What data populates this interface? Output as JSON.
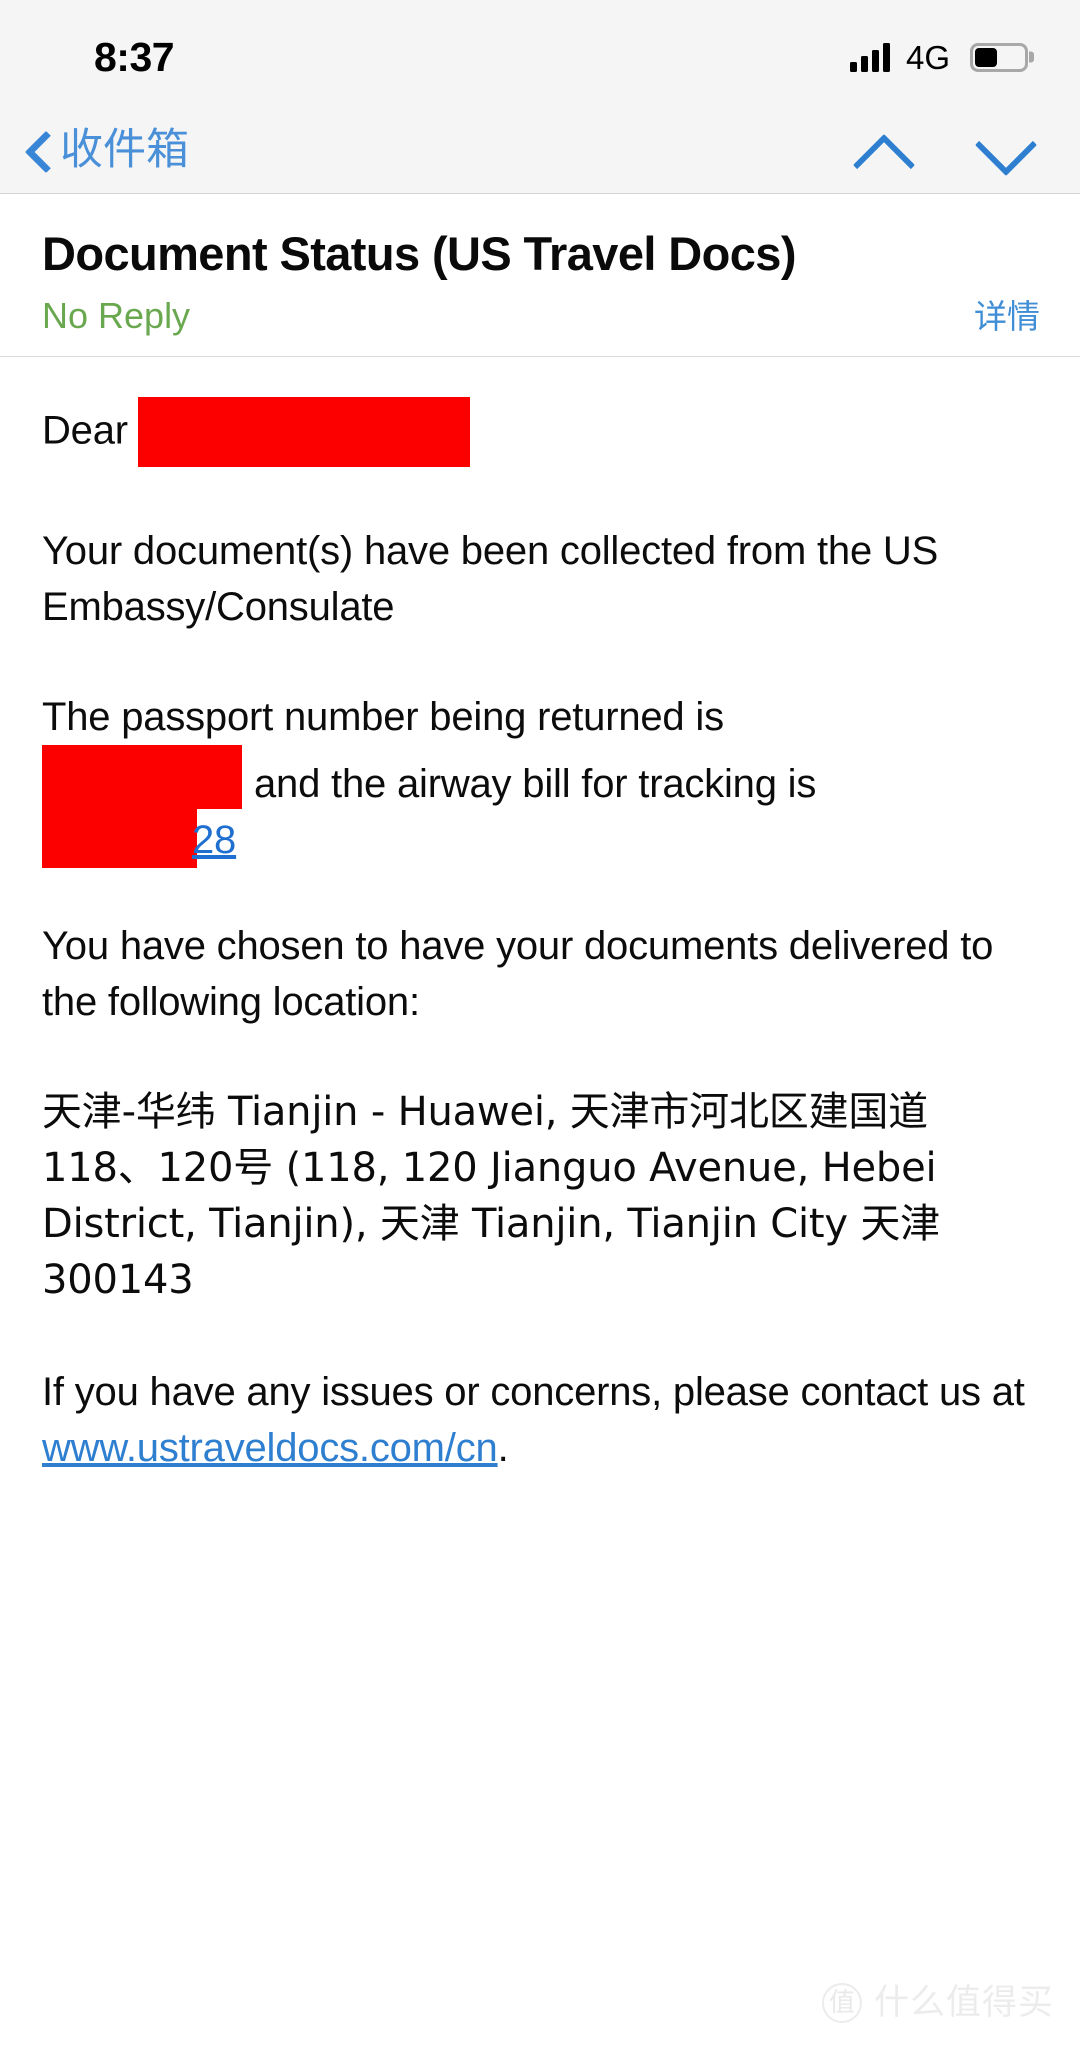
{
  "status_bar": {
    "time": "8:37",
    "network_label": "4G",
    "signal_bars_filled": 4,
    "battery_percent": 45,
    "icons": {
      "signal": "signal-bars-icon",
      "battery": "battery-icon"
    }
  },
  "nav_bar": {
    "back_label": "收件箱",
    "back_icon": "chevron-left-icon",
    "prev_message_icon": "chevron-up-icon",
    "next_message_icon": "chevron-down-icon"
  },
  "mail_header": {
    "subject": "Document Status (US Travel Docs)",
    "sender": "No Reply",
    "details_label": "详情",
    "sender_color": "#6aa84f",
    "details_color": "#3f8ed6"
  },
  "mail_body": {
    "greeting_prefix": "Dear",
    "greeting_redacted": true,
    "paragraph_collected": "Your document(s) have been collected from the US Embassy/Consulate",
    "paragraph_passport_lead": "The passport number being returned is",
    "paragraph_passport_tail": "and the airway bill for tracking is",
    "airway_bill_visible": "28",
    "paragraph_delivery": "You have chosen to have your documents delivered to the following location:",
    "address": "天津-华纬 Tianjin - Huawei, 天津市河北区建国道118、120号 (118, 120 Jianguo Avenue, Hebei District, Tianjin), 天津 Tianjin, Tianjin City 天津 300143",
    "paragraph_contact_lead": "If you have any issues or concerns, please contact us at",
    "contact_link": "www.ustraveldocs.com/cn",
    "paragraph_contact_tail": ".",
    "redaction_color": "#fc0000",
    "link_color": "#2f7fd1"
  },
  "watermark": {
    "badge": "值",
    "text": "什么值得买"
  }
}
